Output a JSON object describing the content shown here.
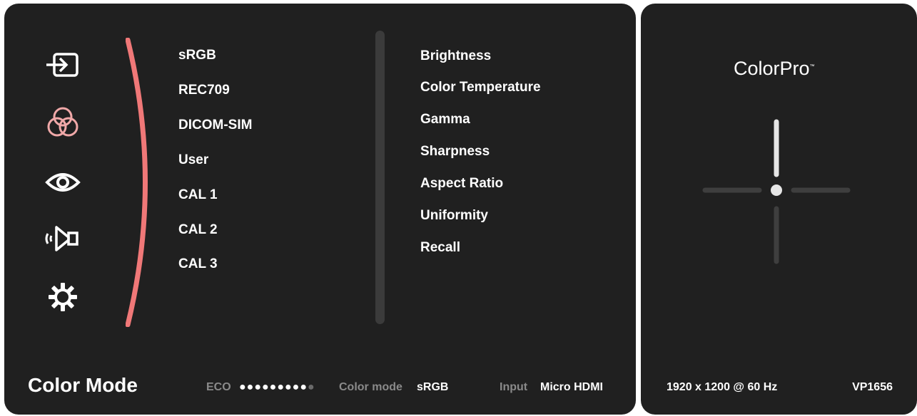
{
  "menu": {
    "icons": [
      "input-icon",
      "color-adjust-icon",
      "eye-icon",
      "audio-icon",
      "gear-icon"
    ],
    "selected_icon": "color-adjust-icon",
    "accent_color": "#f07878"
  },
  "color_modes": [
    "sRGB",
    "REC709",
    "DICOM-SIM",
    "User",
    "CAL 1",
    "CAL 2",
    "CAL 3"
  ],
  "settings": [
    "Brightness",
    "Color Temperature",
    "Gamma",
    "Sharpness",
    "Aspect Ratio",
    "Uniformity",
    "Recall"
  ],
  "footer": {
    "title": "Color Mode",
    "eco_label": "ECO",
    "eco_level": "9/10",
    "color_mode_label": "Color mode",
    "color_mode_value": "sRGB",
    "input_label": "Input",
    "input_value": "Micro HDMI"
  },
  "info": {
    "brand": "ColorPro",
    "trademark": "™",
    "resolution": "1920 x 1200 @ 60 Hz",
    "model": "VP1656"
  }
}
